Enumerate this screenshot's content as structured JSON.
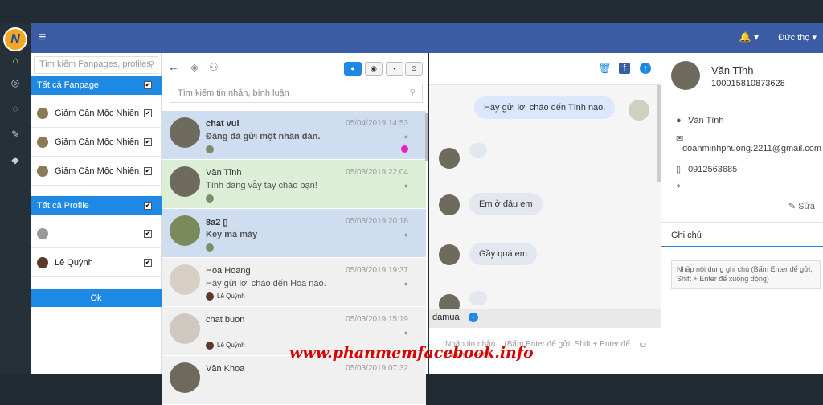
{
  "navbar": {
    "user": "Đức thọ ▾",
    "bell": "🔔 ▾",
    "menu": "≡"
  },
  "filter": {
    "search_placeholder": "Tìm kiếm Fanpages, profiles",
    "fanpage_header": "Tất cả Fanpage",
    "fanpages": [
      "Giảm Cân Mộc Nhiên",
      "Giảm Cân Mộc Nhiên",
      "Giảm Cân Mộc Nhiên"
    ],
    "profile_header": "Tất cả Profile",
    "profiles": [
      "",
      "Lê Quỳnh"
    ],
    "ok": "Ok"
  },
  "conv": {
    "search_placeholder": "Tìm kiếm tin nhắn, bình luận",
    "items": [
      {
        "name": "chat vui",
        "time": "05/04/2019 14:53",
        "msg": "Đăng đã gửi một nhãn dán.",
        "page": ""
      },
      {
        "name": "Văn Tĩnh",
        "time": "05/03/2019 22:04",
        "msg": "Tĩnh đang vẫy tay chào bạn!",
        "page": ""
      },
      {
        "name": "8a2 ▯",
        "time": "05/03/2019 20:18",
        "msg": "Key mà mày",
        "page": ""
      },
      {
        "name": "Hoa Hoang",
        "time": "05/03/2019 19:37",
        "msg": "Hãy gửi lời chào đến Hoa nào.",
        "page": "Lê Quỳnh"
      },
      {
        "name": "chat buon",
        "time": "05/03/2019 15:19",
        "msg": ".",
        "page": "Lê Quỳnh"
      },
      {
        "name": "Văn Khoa",
        "time": "05/03/2019 07:32",
        "msg": "",
        "page": ""
      }
    ]
  },
  "chat": {
    "messages": [
      "Hãy gửi lời chào đến Tĩnh nào.",
      "Em ở đâu em",
      "Gầy quá em"
    ],
    "tag": "damua",
    "input_placeholder": "Nhập tin nhắn... (Bấm Enter để gửi, Shift + Enter để xuống dòng)"
  },
  "profile": {
    "name": "Văn Tĩnh",
    "id": "100015810873628",
    "display_name": "Văn Tĩnh",
    "email": "doanminhphuong.2211@gmail.com",
    "phone": "0912563685",
    "edit": "Sửa",
    "note_tab": "Ghi chú",
    "note_placeholder": "Nhập nội dung ghi chú (Bấm Enter để gửi, Shift + Enter để xuống dòng)"
  },
  "watermark": "www.phanmemfacebook.info",
  "colors": {
    "navbar": "#3b5ba5",
    "accent": "#1e88e5",
    "selected_row": "#cfddf0",
    "highlight_row": "#dcefd6"
  }
}
